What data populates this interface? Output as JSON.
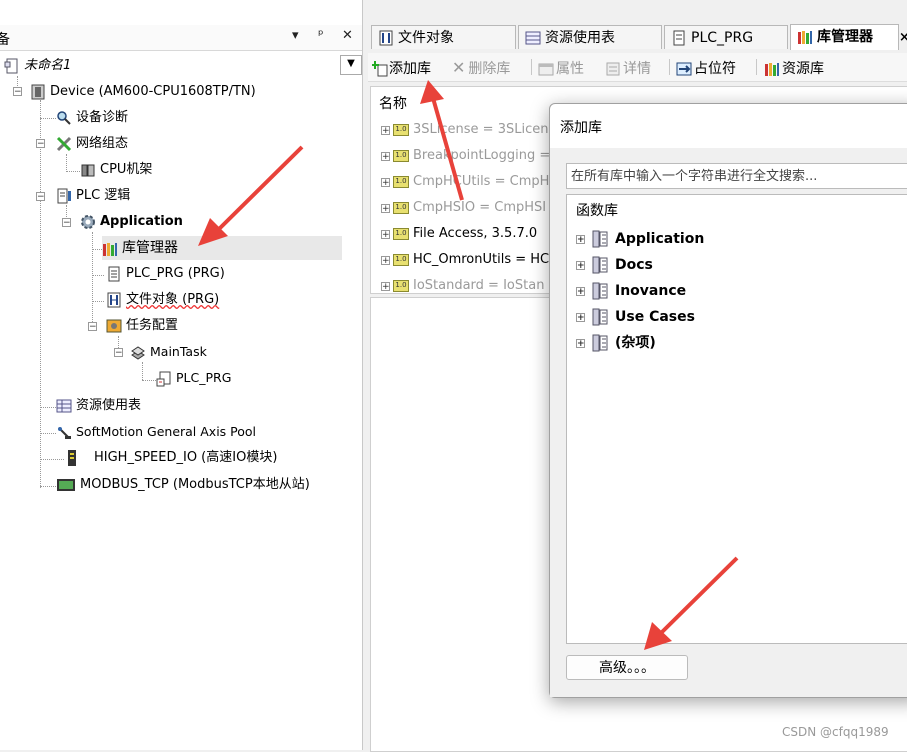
{
  "device_pane": {
    "title": "备",
    "header_buttons": [
      "▾",
      "ᵖ",
      "✕"
    ],
    "tree": [
      {
        "label": "未命名1",
        "italic": true
      },
      {
        "label": "Device (AM600-CPU1608TP/TN)"
      },
      {
        "label": "设备诊断"
      },
      {
        "label": "网络组态"
      },
      {
        "label": "CPU机架"
      },
      {
        "label": "PLC 逻辑"
      },
      {
        "label": "Application",
        "bold": true
      },
      {
        "label": "库管理器"
      },
      {
        "label": "PLC_PRG (PRG)"
      },
      {
        "label": "文件对象 (PRG)"
      },
      {
        "label": "任务配置"
      },
      {
        "label": "MainTask"
      },
      {
        "label": "PLC_PRG"
      },
      {
        "label": "资源使用表"
      },
      {
        "label": "SoftMotion General Axis Pool"
      },
      {
        "label": "HIGH_SPEED_IO (高速IO模块)"
      },
      {
        "label": "MODBUS_TCP (ModbusTCP本地从站)"
      }
    ]
  },
  "editor_tabs": [
    {
      "label": "文件对象"
    },
    {
      "label": "资源使用表"
    },
    {
      "label": "PLC_PRG"
    },
    {
      "label": "库管理器",
      "active": true
    },
    {
      "label": "×"
    }
  ],
  "toolbar": {
    "add_library": "添加库",
    "delete_library": "删除库",
    "properties": "属性",
    "details": "详情",
    "placeholder": "占位符",
    "library_repository": "资源库"
  },
  "library_list": {
    "column_header": "名称",
    "rows": [
      {
        "text": "3SLicense = 3SLicen",
        "dim": true
      },
      {
        "text": "BreakpointLogging =",
        "dim": true
      },
      {
        "text": "CmpHCUtils = CmpH",
        "dim": true
      },
      {
        "text": "CmpHSIO = CmpHSI",
        "dim": true
      },
      {
        "text": "File Access, 3.5.7.0",
        "dim": false
      },
      {
        "text": "HC_OmronUtils = HC",
        "dim": false
      },
      {
        "text": "IoStandard = IoStan",
        "dim": true
      }
    ],
    "version_badge": "1.0"
  },
  "add_library_dialog": {
    "title": "添加库",
    "search_placeholder": "在所有库中输入一个字符串进行全文搜索...",
    "column_header": "函数库",
    "categories": [
      {
        "label": "Application"
      },
      {
        "label": "Docs"
      },
      {
        "label": "Inovance"
      },
      {
        "label": "Use Cases"
      },
      {
        "label": "(杂项)"
      }
    ],
    "advanced_button": "高级。。。"
  },
  "watermark": "CSDN @cfqq1989",
  "colors": {
    "arrow": "#e8423a",
    "selection": "#e8e8e8"
  }
}
